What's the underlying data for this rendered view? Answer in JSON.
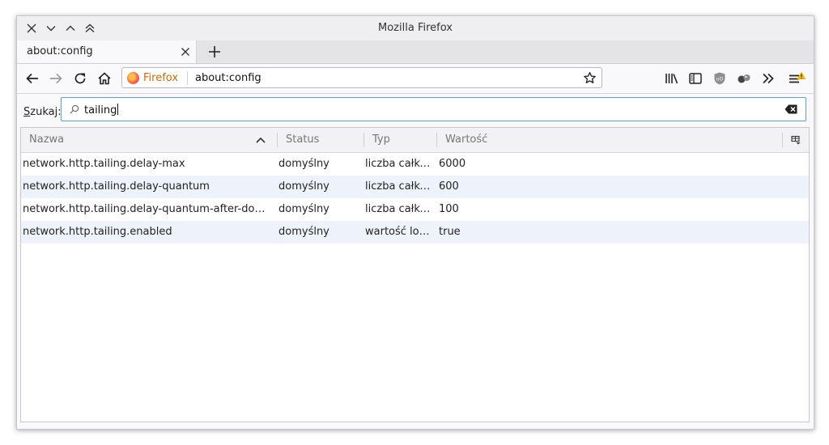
{
  "window": {
    "title": "Mozilla Firefox"
  },
  "tab": {
    "label": "about:config"
  },
  "urlbar": {
    "identity_label": "Firefox",
    "url": "about:config"
  },
  "search": {
    "label_accesskey": "S",
    "label_rest": "zukaj:",
    "value": "tailing"
  },
  "columns": {
    "name": "Nazwa",
    "status": "Status",
    "type": "Typ",
    "value": "Wartość"
  },
  "rows": [
    {
      "name": "network.http.tailing.delay-max",
      "status": "domyślny",
      "type": "liczba całko…",
      "value": "6000"
    },
    {
      "name": "network.http.tailing.delay-quantum",
      "status": "domyślny",
      "type": "liczba całko…",
      "value": "600"
    },
    {
      "name": "network.http.tailing.delay-quantum-after-domco…",
      "status": "domyślny",
      "type": "liczba całko…",
      "value": "100"
    },
    {
      "name": "network.http.tailing.enabled",
      "status": "domyślny",
      "type": "wartość logi…",
      "value": "true"
    }
  ],
  "colors": {
    "accent": "#5aa0d8",
    "identity": "#d06a00",
    "row_alt": "#eef3fb",
    "warning": "#f5b800"
  }
}
